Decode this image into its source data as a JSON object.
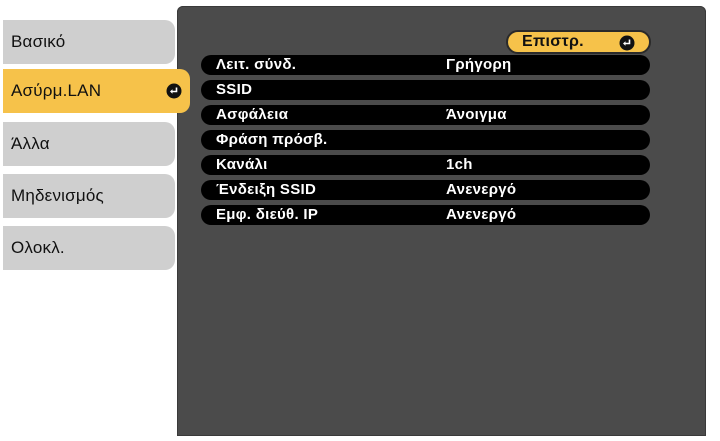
{
  "nav": {
    "items": [
      {
        "label": "Βασικό"
      },
      {
        "label": "Ασύρμ.LAN"
      },
      {
        "label": "Άλλα"
      },
      {
        "label": "Μηδενισμός"
      },
      {
        "label": "Ολοκλ."
      }
    ],
    "active_index": 1
  },
  "back_button": {
    "label": "Επιστρ."
  },
  "settings": [
    {
      "label": "Λειτ. σύνδ.",
      "value": "Γρήγορη"
    },
    {
      "label": "SSID",
      "value": ""
    },
    {
      "label": "Ασφάλεια",
      "value": "Άνοιγμα"
    },
    {
      "label": "Φράση πρόσβ.",
      "value": ""
    },
    {
      "label": "Κανάλι",
      "value": "1ch"
    },
    {
      "label": "Ένδειξη SSID",
      "value": "Ανενεργό"
    },
    {
      "label": "Εμφ. διεύθ. IP",
      "value": "Ανενεργό"
    }
  ],
  "icons": {
    "enter": "enter-icon"
  },
  "colors": {
    "accent": "#f6c24a",
    "panel": "#4b4b4b",
    "tab": "#cfcfcf",
    "row": "#000000"
  }
}
